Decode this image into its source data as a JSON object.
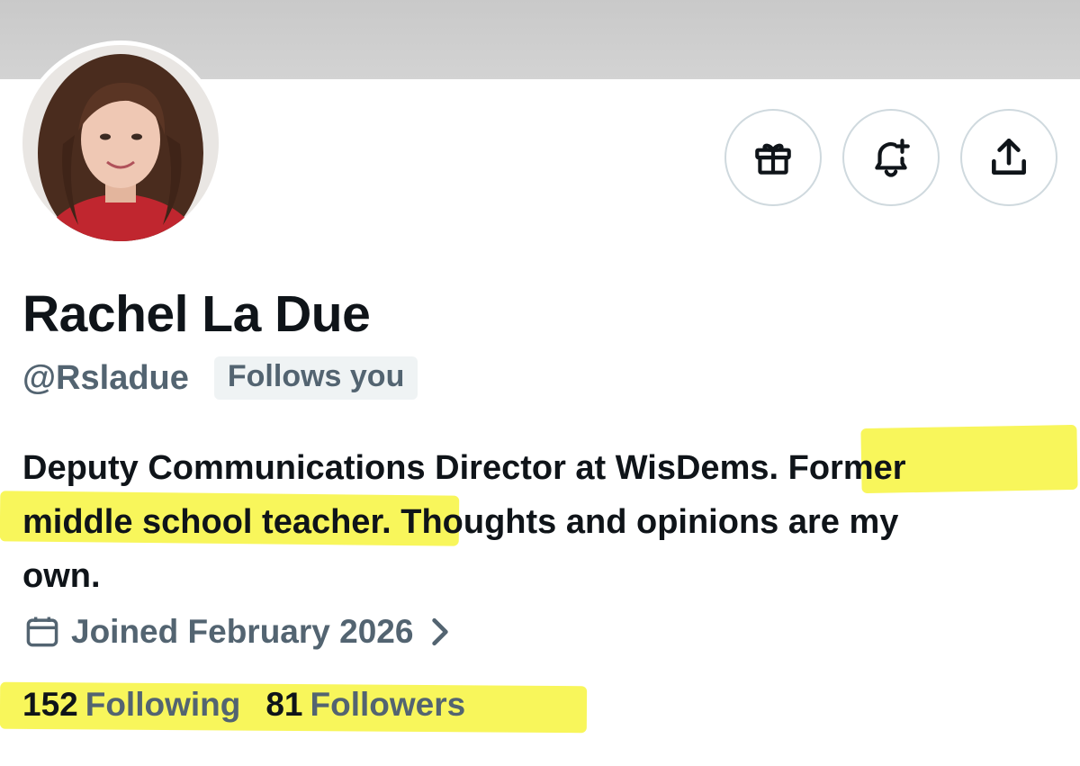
{
  "profile": {
    "name": "Rachel La Due",
    "handle": "@Rsladue",
    "follows_you_badge": "Follows you",
    "bio_lines": [
      "Deputy Communications Director at WisDems. Former",
      "middle school teacher. Thoughts and opinions are my",
      "own."
    ],
    "joined": "Joined February 2026",
    "following_count": "152",
    "following_label": "Following",
    "followers_count": "81",
    "followers_label": "Followers"
  },
  "actions": {
    "icons": [
      "gift-icon",
      "bell-plus-icon",
      "share-icon"
    ]
  },
  "colors": {
    "primary_text": "#0f1419",
    "secondary_text": "#536471",
    "badge_bg": "#eff3f4",
    "highlight": "#f7f43e",
    "banner": "#cfcfcf"
  }
}
